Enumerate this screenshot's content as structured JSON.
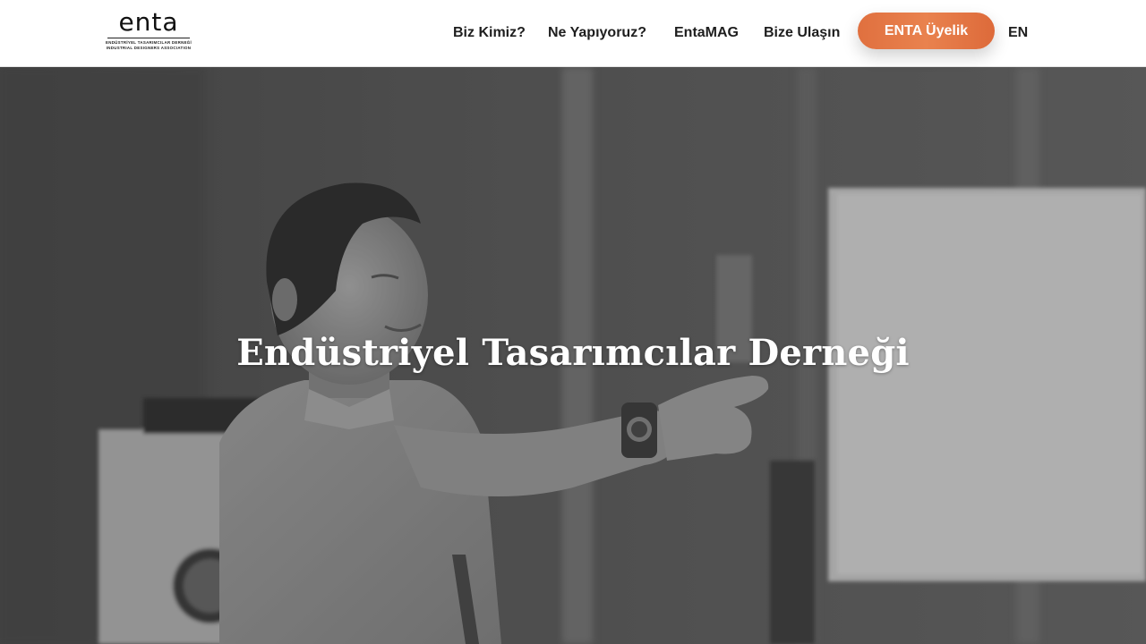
{
  "header": {
    "logo": {
      "wordmark": "enta",
      "subtitle_line1": "ENDÜSTRİYEL TASARIMCILAR DERNEĞİ",
      "subtitle_line2": "INDUSTRIAL DESIGNERS ASSOCIATION"
    },
    "nav": [
      {
        "label": "Biz Kimiz?"
      },
      {
        "label": "Ne Yapıyoruz?"
      },
      {
        "label": "EntaMAG"
      },
      {
        "label": "Bize Ulaşın"
      }
    ],
    "cta_label": "ENTA Üyelik",
    "lang_label": "EN"
  },
  "hero": {
    "title": "Endüstriyel Tasarımcılar Derneği",
    "image_description_icon": "presenter-photo"
  },
  "colors": {
    "accent": "#e47748",
    "nav_text": "#1e1e1e",
    "hero_text": "#ffffff"
  }
}
